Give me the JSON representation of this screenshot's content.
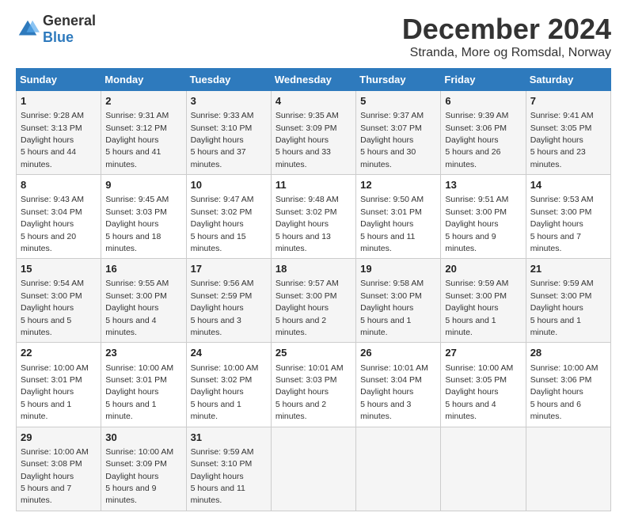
{
  "header": {
    "logo_general": "General",
    "logo_blue": "Blue",
    "main_title": "December 2024",
    "subtitle": "Stranda, More og Romsdal, Norway"
  },
  "calendar": {
    "headers": [
      "Sunday",
      "Monday",
      "Tuesday",
      "Wednesday",
      "Thursday",
      "Friday",
      "Saturday"
    ],
    "weeks": [
      [
        null,
        null,
        null,
        null,
        {
          "day": "5",
          "sunrise": "9:37 AM",
          "sunset": "3:07 PM",
          "daylight": "5 hours and 30 minutes."
        },
        {
          "day": "6",
          "sunrise": "9:39 AM",
          "sunset": "3:06 PM",
          "daylight": "5 hours and 26 minutes."
        },
        {
          "day": "7",
          "sunrise": "9:41 AM",
          "sunset": "3:05 PM",
          "daylight": "5 hours and 23 minutes."
        }
      ],
      [
        {
          "day": "1",
          "sunrise": "9:28 AM",
          "sunset": "3:13 PM",
          "daylight": "5 hours and 44 minutes."
        },
        {
          "day": "2",
          "sunrise": "9:31 AM",
          "sunset": "3:12 PM",
          "daylight": "5 hours and 41 minutes."
        },
        {
          "day": "3",
          "sunrise": "9:33 AM",
          "sunset": "3:10 PM",
          "daylight": "5 hours and 37 minutes."
        },
        {
          "day": "4",
          "sunrise": "9:35 AM",
          "sunset": "3:09 PM",
          "daylight": "5 hours and 33 minutes."
        },
        {
          "day": "5",
          "sunrise": "9:37 AM",
          "sunset": "3:07 PM",
          "daylight": "5 hours and 30 minutes."
        },
        {
          "day": "6",
          "sunrise": "9:39 AM",
          "sunset": "3:06 PM",
          "daylight": "5 hours and 26 minutes."
        },
        {
          "day": "7",
          "sunrise": "9:41 AM",
          "sunset": "3:05 PM",
          "daylight": "5 hours and 23 minutes."
        }
      ],
      [
        {
          "day": "8",
          "sunrise": "9:43 AM",
          "sunset": "3:04 PM",
          "daylight": "5 hours and 20 minutes."
        },
        {
          "day": "9",
          "sunrise": "9:45 AM",
          "sunset": "3:03 PM",
          "daylight": "5 hours and 18 minutes."
        },
        {
          "day": "10",
          "sunrise": "9:47 AM",
          "sunset": "3:02 PM",
          "daylight": "5 hours and 15 minutes."
        },
        {
          "day": "11",
          "sunrise": "9:48 AM",
          "sunset": "3:02 PM",
          "daylight": "5 hours and 13 minutes."
        },
        {
          "day": "12",
          "sunrise": "9:50 AM",
          "sunset": "3:01 PM",
          "daylight": "5 hours and 11 minutes."
        },
        {
          "day": "13",
          "sunrise": "9:51 AM",
          "sunset": "3:00 PM",
          "daylight": "5 hours and 9 minutes."
        },
        {
          "day": "14",
          "sunrise": "9:53 AM",
          "sunset": "3:00 PM",
          "daylight": "5 hours and 7 minutes."
        }
      ],
      [
        {
          "day": "15",
          "sunrise": "9:54 AM",
          "sunset": "3:00 PM",
          "daylight": "5 hours and 5 minutes."
        },
        {
          "day": "16",
          "sunrise": "9:55 AM",
          "sunset": "3:00 PM",
          "daylight": "5 hours and 4 minutes."
        },
        {
          "day": "17",
          "sunrise": "9:56 AM",
          "sunset": "2:59 PM",
          "daylight": "5 hours and 3 minutes."
        },
        {
          "day": "18",
          "sunrise": "9:57 AM",
          "sunset": "3:00 PM",
          "daylight": "5 hours and 2 minutes."
        },
        {
          "day": "19",
          "sunrise": "9:58 AM",
          "sunset": "3:00 PM",
          "daylight": "5 hours and 1 minute."
        },
        {
          "day": "20",
          "sunrise": "9:59 AM",
          "sunset": "3:00 PM",
          "daylight": "5 hours and 1 minute."
        },
        {
          "day": "21",
          "sunrise": "9:59 AM",
          "sunset": "3:00 PM",
          "daylight": "5 hours and 1 minute."
        }
      ],
      [
        {
          "day": "22",
          "sunrise": "10:00 AM",
          "sunset": "3:01 PM",
          "daylight": "5 hours and 1 minute."
        },
        {
          "day": "23",
          "sunrise": "10:00 AM",
          "sunset": "3:01 PM",
          "daylight": "5 hours and 1 minute."
        },
        {
          "day": "24",
          "sunrise": "10:00 AM",
          "sunset": "3:02 PM",
          "daylight": "5 hours and 1 minute."
        },
        {
          "day": "25",
          "sunrise": "10:01 AM",
          "sunset": "3:03 PM",
          "daylight": "5 hours and 2 minutes."
        },
        {
          "day": "26",
          "sunrise": "10:01 AM",
          "sunset": "3:04 PM",
          "daylight": "5 hours and 3 minutes."
        },
        {
          "day": "27",
          "sunrise": "10:00 AM",
          "sunset": "3:05 PM",
          "daylight": "5 hours and 4 minutes."
        },
        {
          "day": "28",
          "sunrise": "10:00 AM",
          "sunset": "3:06 PM",
          "daylight": "5 hours and 6 minutes."
        }
      ],
      [
        {
          "day": "29",
          "sunrise": "10:00 AM",
          "sunset": "3:08 PM",
          "daylight": "5 hours and 7 minutes."
        },
        {
          "day": "30",
          "sunrise": "10:00 AM",
          "sunset": "3:09 PM",
          "daylight": "5 hours and 9 minutes."
        },
        {
          "day": "31",
          "sunrise": "9:59 AM",
          "sunset": "3:10 PM",
          "daylight": "5 hours and 11 minutes."
        },
        null,
        null,
        null,
        null
      ]
    ]
  }
}
